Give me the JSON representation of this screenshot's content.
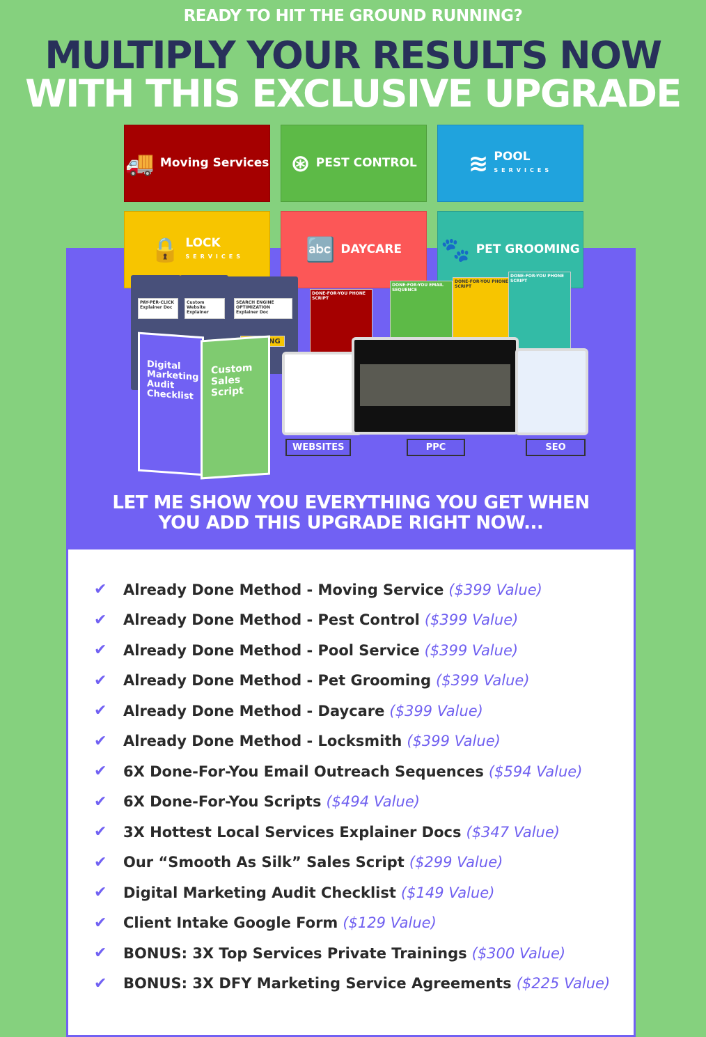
{
  "header": {
    "pretitle": "READY TO HIT THE GROUND RUNNING?",
    "title_line1": "MULTIPLY YOUR RESULTS NOW",
    "title_line2": "WITH THIS EXCLUSIVE UPGRADE"
  },
  "tiles": [
    {
      "name": "Moving Services",
      "sub": "",
      "icon": "truck-icon",
      "color": "#a50000"
    },
    {
      "name": "PEST CONTROL",
      "sub": "",
      "icon": "bug-icon",
      "color": "#5dba47"
    },
    {
      "name": "POOL",
      "sub": "SERVICES",
      "icon": "swimmer-icon",
      "color": "#20a3dd"
    },
    {
      "name": "LOCK",
      "sub": "SERVICES",
      "icon": "lock-icon",
      "color": "#f7c500"
    },
    {
      "name": "DAYCARE",
      "sub": "",
      "icon": "abc-blocks-icon",
      "color": "#fc5757"
    },
    {
      "name": "PET GROOMING",
      "sub": "",
      "icon": "paw-icon",
      "color": "#33bba6"
    }
  ],
  "mockup": {
    "docs": [
      "PAY-PER-CLICK Explainer Doc",
      "Custom Website Explainer",
      "SEARCH ENGINE OPTIMIZATION Explainer Doc"
    ],
    "book1": "Digital Marketing Audit Checklist",
    "book2": "Custom Sales Script",
    "warning": "WARNING",
    "scripts_label": "DONE-FOR-YOU PHONE SCRIPT",
    "email_label": "DONE-FOR-YOU EMAIL SEQUENCE",
    "monitors": [
      "WEBSITES",
      "PPC",
      "SEO"
    ]
  },
  "cta": {
    "line1": "LET ME SHOW YOU EVERYTHING YOU GET WHEN",
    "line2": "YOU ADD THIS UPGRADE RIGHT NOW..."
  },
  "items": [
    {
      "text": "Already Done Method - Moving Service",
      "value": "($399 Value)"
    },
    {
      "text": "Already Done Method - Pest Control",
      "value": "($399 Value)"
    },
    {
      "text": "Already Done Method - Pool Service",
      "value": "($399 Value)"
    },
    {
      "text": "Already Done Method - Pet Grooming",
      "value": "($399 Value)"
    },
    {
      "text": "Already Done Method - Daycare",
      "value": "($399 Value)"
    },
    {
      "text": "Already Done Method - Locksmith",
      "value": "($399 Value)"
    },
    {
      "text": "6X Done-For-You Email Outreach Sequences",
      "value": "($594 Value)"
    },
    {
      "text": "6X Done-For-You Scripts",
      "value": "($494 Value)"
    },
    {
      "text": "3X Hottest Local Services Explainer Docs",
      "value": "($347 Value)"
    },
    {
      "text": "Our “Smooth As Silk” Sales Script",
      "value": "($299 Value)"
    },
    {
      "text": "Digital Marketing Audit Checklist",
      "value": "($149 Value)"
    },
    {
      "text": "Client Intake Google Form",
      "value": "($129 Value)"
    },
    {
      "text": "BONUS: 3X Top Services Private Trainings",
      "value": "($300 Value)"
    },
    {
      "text": "BONUS: 3X DFY Marketing Service Agreements",
      "value": "($225 Value)"
    }
  ]
}
